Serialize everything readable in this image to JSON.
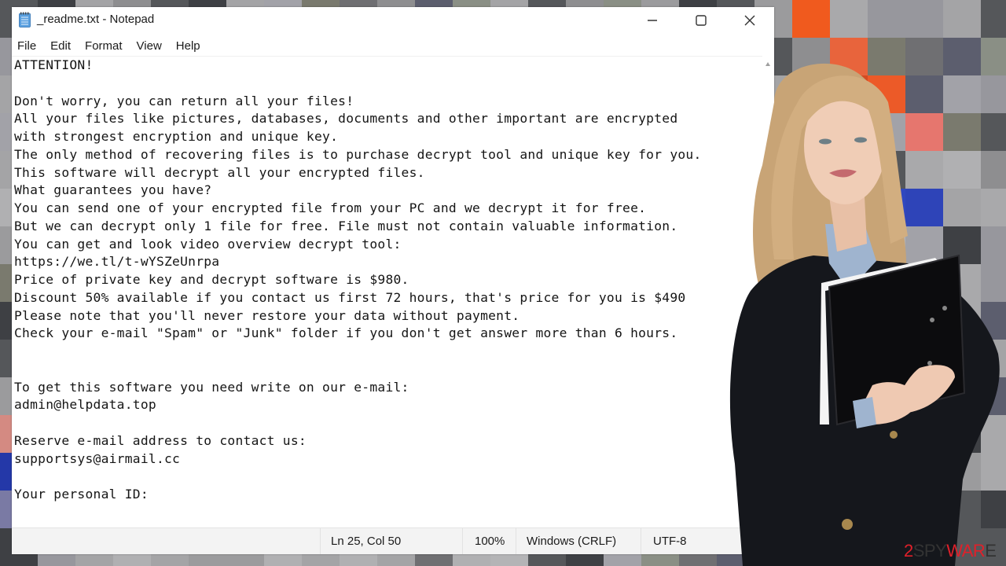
{
  "window": {
    "title": "_readme.txt - Notepad",
    "controls": {
      "minimize": "minimize",
      "maximize": "maximize",
      "close": "close"
    }
  },
  "menu": [
    "File",
    "Edit",
    "Format",
    "View",
    "Help"
  ],
  "document": {
    "lines": [
      "ATTENTION!",
      "",
      "Don't worry, you can return all your files!",
      "All your files like pictures, databases, documents and other important are encrypted",
      "with strongest encryption and unique key.",
      "The only method of recovering files is to purchase decrypt tool and unique key for you.",
      "This software will decrypt all your encrypted files.",
      "What guarantees you have?",
      "You can send one of your encrypted file from your PC and we decrypt it for free.",
      "But we can decrypt only 1 file for free. File must not contain valuable information.",
      "You can get and look video overview decrypt tool:",
      "https://we.tl/t-wYSZeUnrpa",
      "Price of private key and decrypt software is $980.",
      "Discount 50% available if you contact us first 72 hours, that's price for you is $490",
      "Please note that you'll never restore your data without payment.",
      "Check your e-mail \"Spam\" or \"Junk\" folder if you don't get answer more than 6 hours.",
      "",
      "",
      "To get this software you need write on our e-mail:",
      "admin@helpdata.top",
      "",
      "Reserve e-mail address to contact us:",
      "supportsys@airmail.cc",
      "",
      "Your personal ID:"
    ]
  },
  "status": {
    "position": "Ln 25, Col 50",
    "zoom": "100%",
    "line_ending": "Windows (CRLF)",
    "encoding": "UTF-8"
  },
  "watermark": {
    "prefix": "2",
    "spy": "SPY",
    "ware": "WAR",
    "suffix": "E"
  },
  "colors": {
    "watermark_red": "#e0202a",
    "notepad_icon": "#4a8fd4"
  }
}
